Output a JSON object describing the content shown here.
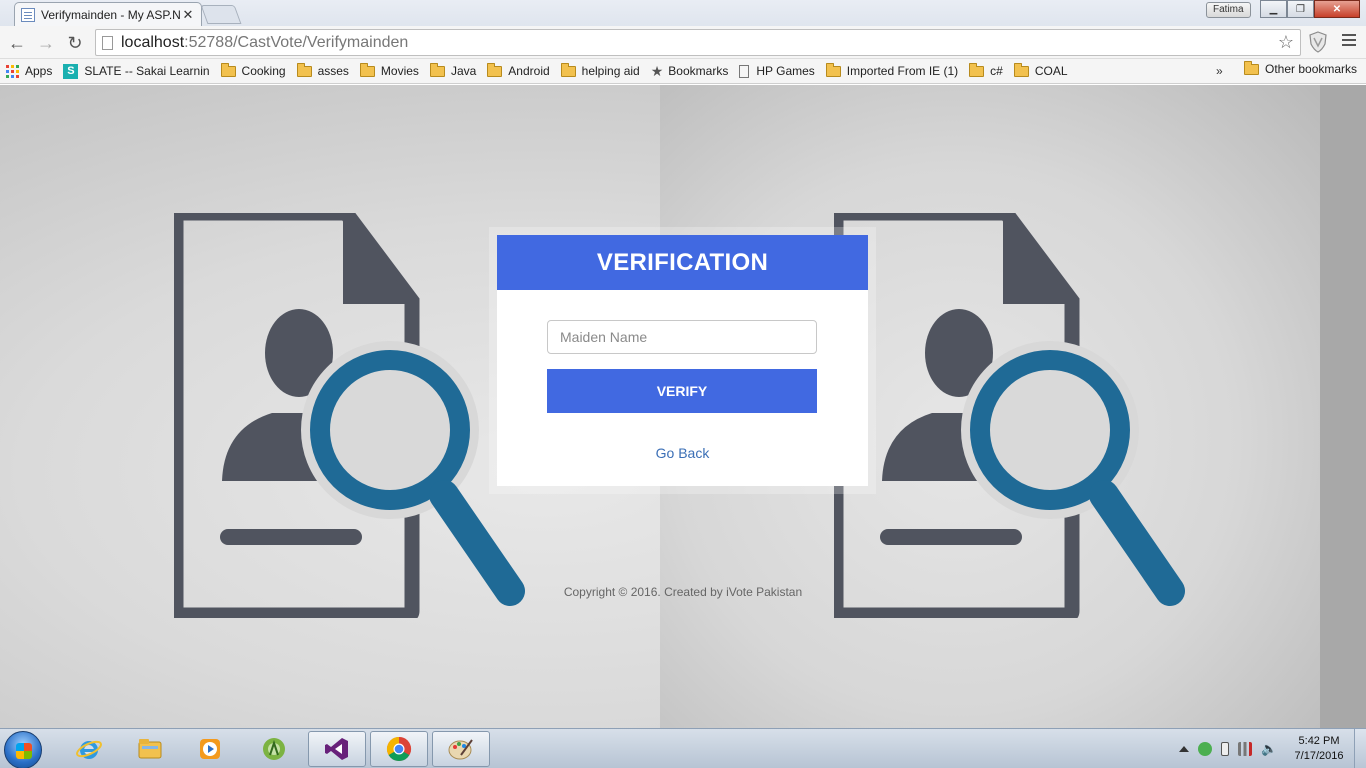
{
  "browser": {
    "tab_title": "Verifymainden - My ASP.N",
    "profile_name": "Fatima",
    "url_host": "localhost",
    "url_path": ":52788/CastVote/Verifymainden"
  },
  "bookmarks": {
    "apps_label": "Apps",
    "items": [
      {
        "label": "SLATE -- Sakai Learnin",
        "icon": "slate-icon"
      },
      {
        "label": "Cooking",
        "icon": "folder-icon"
      },
      {
        "label": "asses",
        "icon": "folder-icon"
      },
      {
        "label": "Movies",
        "icon": "folder-icon"
      },
      {
        "label": "Java",
        "icon": "folder-icon"
      },
      {
        "label": "Android",
        "icon": "folder-icon"
      },
      {
        "label": "helping aid",
        "icon": "folder-icon"
      },
      {
        "label": "Bookmarks",
        "icon": "star-icon"
      },
      {
        "label": "HP Games",
        "icon": "page-icon"
      },
      {
        "label": "Imported From IE (1)",
        "icon": "folder-icon"
      },
      {
        "label": "c#",
        "icon": "folder-icon"
      },
      {
        "label": "COAL",
        "icon": "folder-icon"
      }
    ],
    "overflow": "»",
    "other_label": "Other bookmarks"
  },
  "page": {
    "card_title": "VERIFICATION",
    "maiden_placeholder": "Maiden Name",
    "verify_label": "VERIFY",
    "go_back_label": "Go Back",
    "copyright": "Copyright © 2016. Created by iVote Pakistan",
    "colors": {
      "accent": "#4169e1",
      "link": "#3b6fb6",
      "illustration_dark": "#50545f",
      "illustration_blue": "#1f6a96"
    }
  },
  "taskbar": {
    "apps": [
      "internet-explorer-icon",
      "file-explorer-icon",
      "media-player-icon",
      "android-studio-icon",
      "visual-studio-icon",
      "chrome-icon",
      "paint-icon"
    ],
    "time": "5:42 PM",
    "date": "7/17/2016"
  }
}
